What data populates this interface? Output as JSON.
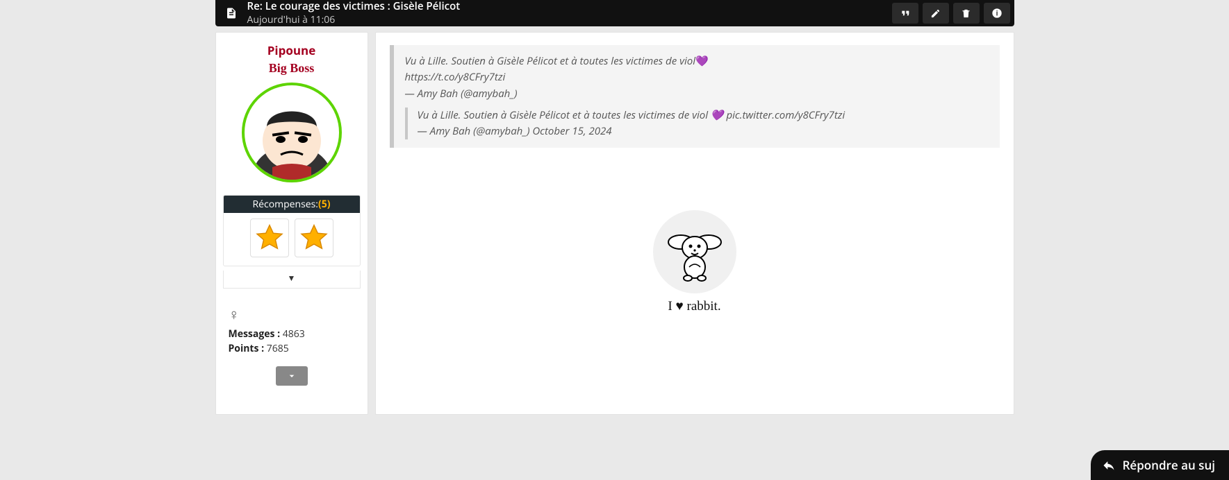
{
  "header": {
    "title": "Re: Le courage des victimes : Gisèle Pélicot",
    "timestamp": "Aujourd'hui à 11:06",
    "actions": {
      "quote": "❝❞",
      "edit": "✎",
      "delete": "🗑",
      "info": "i"
    }
  },
  "profile": {
    "username": "Pipoune",
    "rank": "Big Boss",
    "rewards_label": "Récompenses:",
    "rewards_count": "(5)",
    "expand_glyph": "▼",
    "gender_glyph": "♀",
    "messages_label": "Messages :",
    "messages_value": "4863",
    "points_label": "Points :",
    "points_value": "7685"
  },
  "post": {
    "q1_text": "Vu à Lille. Soutien à Gisèle Pélicot et à toutes les victimes de viol",
    "q1_heart": "💜",
    "q1_link": "https://t.co/y8CFry7tzi",
    "q1_author": "— Amy Bah (@amybah_)",
    "q2_text": "Vu à Lille. Soutien à Gisèle Pélicot et à toutes les victimes de viol 💜 pic.twitter.com/y8CFry7tzi",
    "q2_author_date": "— Amy Bah (@amybah_) October 15, 2024"
  },
  "signature": {
    "text": "I ♥ rabbit."
  },
  "reply": {
    "label": "Répondre au suj"
  }
}
